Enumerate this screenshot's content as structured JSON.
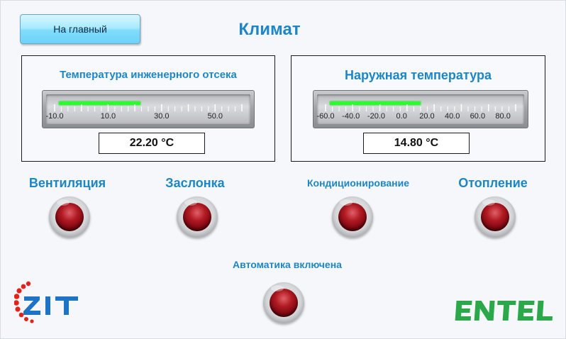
{
  "header": {
    "home_button": "На главный",
    "title": "Климат"
  },
  "panels": [
    {
      "title": "Температура инженерного отсека",
      "gauge": {
        "min": -10.0,
        "max": 60.0,
        "ticks": [
          "-10.0",
          "10.0",
          "30.0",
          "50.0"
        ],
        "value": 22.2
      },
      "value_text": "22.20 °C"
    },
    {
      "title": "Наружная температура",
      "gauge": {
        "min": -60.0,
        "max": 90.0,
        "ticks": [
          "-60.0",
          "-40.0",
          "-20.0",
          "0.0",
          "20.0",
          "40.0",
          "60.0",
          "80.0"
        ],
        "value": 14.8
      },
      "value_text": "14.80 °C"
    }
  ],
  "indicators": [
    {
      "label": "Вентиляция",
      "state": "off"
    },
    {
      "label": "Заслонка",
      "state": "off"
    },
    {
      "label": "Кондиционирование",
      "state": "off"
    },
    {
      "label": "Отопление",
      "state": "off"
    },
    {
      "label": "Автоматика включена",
      "state": "off"
    }
  ],
  "logos": {
    "left": "ZIT",
    "right": "ENTEL"
  },
  "colors": {
    "accent": "#1d86c6",
    "gauge_fill": "#2bff2b",
    "lamp_off": "#9a0f18",
    "zit_blue": "#1d73c6",
    "zit_red": "#e2231a",
    "entel_green": "#2aa84a"
  }
}
